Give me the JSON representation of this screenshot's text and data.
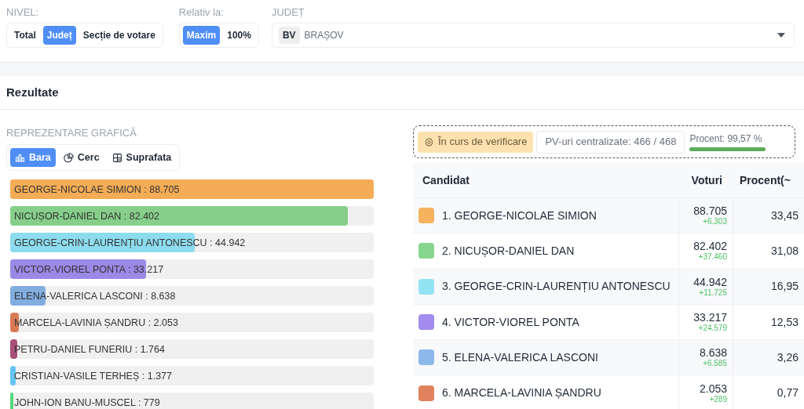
{
  "filters": {
    "nivel": {
      "label": "NIVEL:",
      "options": [
        {
          "label": "Total",
          "selected": false
        },
        {
          "label": "Județ",
          "selected": true
        },
        {
          "label": "Secție de votare",
          "selected": false
        }
      ]
    },
    "relativ": {
      "label": "Relativ la:",
      "options": [
        {
          "label": "Maxim",
          "selected": true
        },
        {
          "label": "100%",
          "selected": false
        }
      ]
    },
    "judet": {
      "label": "JUDEȚ",
      "code": "BV",
      "value": "BRAȘOV"
    }
  },
  "results": {
    "title": "Rezultate",
    "chart_section": {
      "label": "REPREZENTARE GRAFICĂ",
      "tabs": [
        {
          "label": "Bara",
          "kind": "bar",
          "selected": true
        },
        {
          "label": "Cerc",
          "kind": "pie",
          "selected": false
        },
        {
          "label": "Suprafata",
          "kind": "area",
          "selected": false
        }
      ],
      "bars": [
        {
          "label": "GEORGE-NICOLAE SIMION : 88.705",
          "level": 1,
          "color": "#f4ac56"
        },
        {
          "label": "NICUȘOR-DANIEL DAN : 82.402",
          "level": 0.929,
          "color": "#86cf8a"
        },
        {
          "label": "GEORGE-CRIN-LAURENȚIU ANTONESCU : 44.942",
          "level": 0.507,
          "color": "#8ddcee"
        },
        {
          "label": "VICTOR-VIOREL PONTA : 33.217",
          "level": 0.374,
          "color": "#9b89e6"
        },
        {
          "label": "ELENA-VALERICA LASCONI : 8.638",
          "level": 0.097,
          "color": "#82addf"
        },
        {
          "label": "MARCELA-LAVINIA ȘANDRU : 2.053",
          "level": 0.023,
          "color": "#d97a55"
        },
        {
          "label": "PETRU-DANIEL FUNERIU : 1.764",
          "level": 0.02,
          "color": "#a8507a"
        },
        {
          "label": "CRISTIAN-VASILE TERHEȘ : 1.377",
          "level": 0.016,
          "color": "#66c4f2"
        },
        {
          "label": "JOHN-ION BANU-MUSCEL : 779",
          "level": 0.009,
          "color": "#55d77d"
        }
      ]
    },
    "status": {
      "verification": "În curs de verificare",
      "pv": "PV-uri centralizate: 466 / 468",
      "percent_label": "Procent: 99,57 %",
      "level": 0.9957
    },
    "table": {
      "columns": [
        "Candidat",
        "Voturi",
        "Procent(~"
      ],
      "rows": [
        {
          "candidate": "1. GEORGE-NICOLAE SIMION",
          "color": "#f5b35e",
          "votes": "88.705",
          "delta": "+6.303",
          "percent": "33,45"
        },
        {
          "candidate": "2. NICUȘOR-DANIEL DAN",
          "color": "#86d68e",
          "votes": "82.402",
          "delta": "+37.460",
          "percent": "31,08"
        },
        {
          "candidate": "3. GEORGE-CRIN-LAURENȚIU ANTONESCU",
          "color": "#93e4f2",
          "votes": "44.942",
          "delta": "+11.725",
          "percent": "16,95"
        },
        {
          "candidate": "4. VICTOR-VIOREL PONTA",
          "color": "#a28ced",
          "votes": "33.217",
          "delta": "+24.579",
          "percent": "12,53"
        },
        {
          "candidate": "5. ELENA-VALERICA LASCONI",
          "color": "#8db8ec",
          "votes": "8.638",
          "delta": "+6.585",
          "percent": "3,26"
        },
        {
          "candidate": "6. MARCELA-LAVINIA ȘANDRU",
          "color": "#e0825d",
          "votes": "2.053",
          "delta": "+289",
          "percent": "0,77"
        }
      ]
    }
  }
}
